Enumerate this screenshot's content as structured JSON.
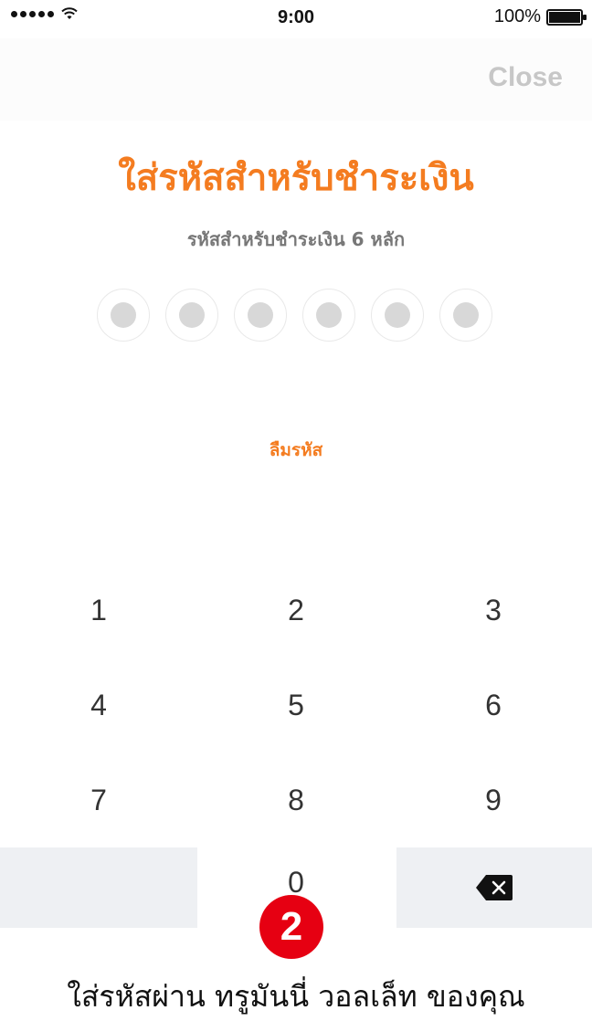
{
  "status_bar": {
    "time": "9:00",
    "battery": "100%"
  },
  "nav": {
    "close_label": "Close"
  },
  "main": {
    "title": "ใส่รหัสสำหรับชำระเงิน",
    "subtitle": "รหัสสำหรับชำระเงิน 6 หลัก",
    "forgot_label": "ลืมรหัส"
  },
  "keypad": {
    "keys": [
      "1",
      "2",
      "3",
      "4",
      "5",
      "6",
      "7",
      "8",
      "9",
      "0"
    ]
  },
  "step_badge": "2",
  "caption": "ใส่รหัสผ่าน ทรูมันนี่ วอลเล็ท ของคุณ",
  "colors": {
    "accent": "#f47c20",
    "badge": "#e60012"
  }
}
